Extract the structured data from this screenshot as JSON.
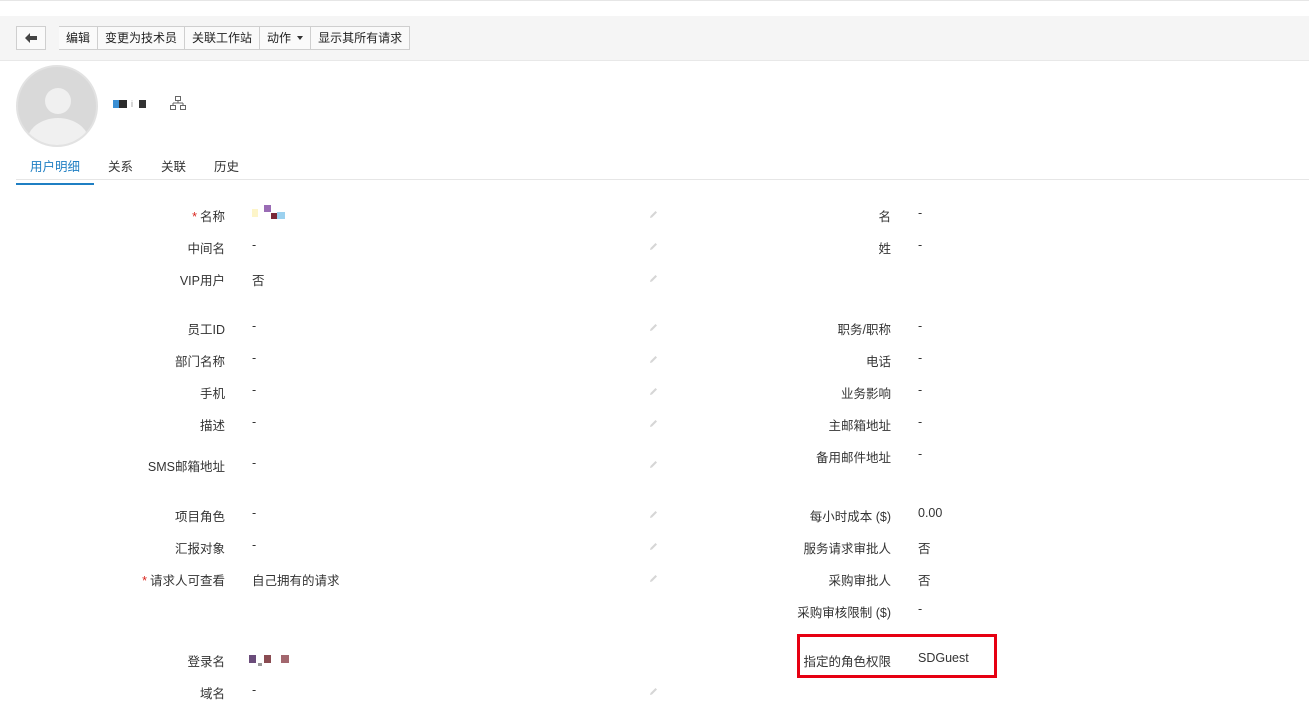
{
  "toolbar": {
    "back_icon": "arrow-left-icon",
    "edit": "编辑",
    "change_to_technician": "变更为技术员",
    "link_workstation": "关联工作站",
    "actions": "动作",
    "show_all_requests": "显示其所有请求"
  },
  "tabs": [
    "用户明细",
    "关系",
    "关联",
    "历史"
  ],
  "left_fields": [
    {
      "label": "名称",
      "required": true,
      "value": "",
      "redacted": true
    },
    {
      "label": "中间名",
      "value": "-"
    },
    {
      "label": "VIP用户",
      "value": "否"
    },
    {
      "label": "员工ID",
      "value": "-"
    },
    {
      "label": "部门名称",
      "value": "-"
    },
    {
      "label": "手机",
      "value": "-"
    },
    {
      "label": "描述",
      "value": "-"
    },
    {
      "label": "SMS邮箱地址",
      "value": "-"
    },
    {
      "label": "项目角色",
      "value": "-"
    },
    {
      "label": "汇报对象",
      "value": "-"
    },
    {
      "label": "请求人可查看",
      "required": true,
      "value": "自己拥有的请求"
    },
    {
      "label": "登录名",
      "value": "",
      "redacted": true
    },
    {
      "label": "域名",
      "value": "-"
    }
  ],
  "right_fields": [
    {
      "label": "名",
      "value": "-"
    },
    {
      "label": "姓",
      "value": "-"
    },
    {
      "label": "职务/职称",
      "value": "-"
    },
    {
      "label": "电话",
      "value": "-"
    },
    {
      "label": "业务影响",
      "value": "-"
    },
    {
      "label": "主邮箱地址",
      "value": "-"
    },
    {
      "label": "备用邮件地址",
      "value": "-"
    },
    {
      "label": "每小时成本 ($)",
      "value": "0.00"
    },
    {
      "label": "服务请求审批人",
      "value": "否"
    },
    {
      "label": "采购审批人",
      "value": "否"
    },
    {
      "label": "采购审核限制 ($)",
      "value": "-"
    },
    {
      "label": "指定的角色权限",
      "value": "SDGuest",
      "highlighted": true
    }
  ],
  "colors": {
    "accent": "#1f7fc3",
    "required": "#d9251d",
    "highlight_box": "#e60012"
  }
}
